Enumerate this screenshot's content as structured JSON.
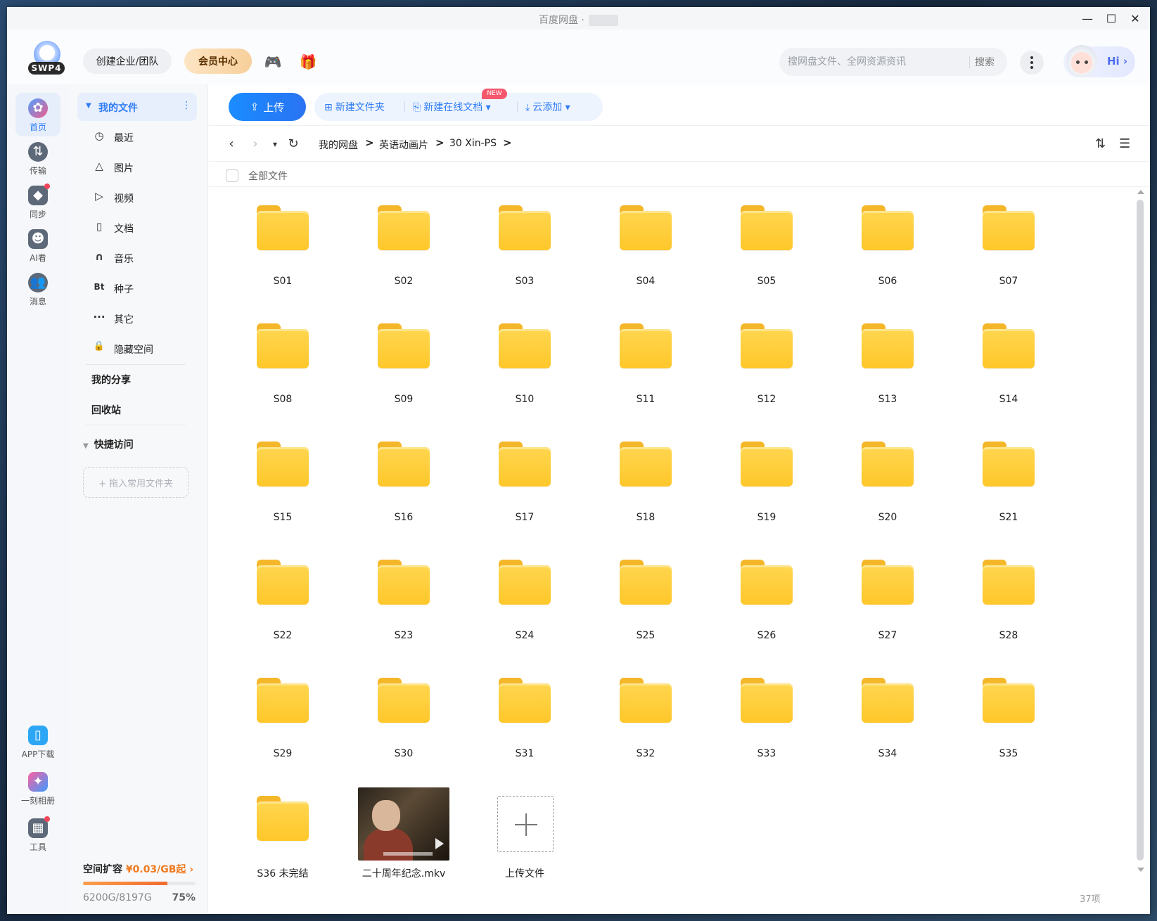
{
  "window": {
    "title": "百度网盘 ·",
    "controls": {
      "minimize": "—",
      "maximize": "☐",
      "close": "✕"
    }
  },
  "header": {
    "logo_badge": "SWP4",
    "team_button": "创建企业/团队",
    "vip_button": "会员中心",
    "game_icon": "🎮",
    "gift_icon": "🎁",
    "search": {
      "placeholder": "搜网盘文件、全网资源资讯",
      "button": "搜索"
    },
    "hi_label": "Hi ›"
  },
  "rail": {
    "items": [
      {
        "label": "首页",
        "icon": "home-icon",
        "active": true
      },
      {
        "label": "传输",
        "icon": "transfer-icon"
      },
      {
        "label": "同步",
        "icon": "sync-icon",
        "dot": true
      },
      {
        "label": "AI看",
        "icon": "ai-icon"
      },
      {
        "label": "消息",
        "icon": "message-icon"
      }
    ],
    "bottom": [
      {
        "label": "APP下载",
        "icon": "phone-icon"
      },
      {
        "label": "一刻相册",
        "icon": "album-icon"
      },
      {
        "label": "工具",
        "icon": "tools-icon",
        "dot": true
      }
    ]
  },
  "sidebar": {
    "my_files": "我的文件",
    "my_files_more": "⋮",
    "items": [
      {
        "icon": "◷",
        "label": "最近"
      },
      {
        "icon": "△",
        "label": "图片"
      },
      {
        "icon": "▷",
        "label": "视频"
      },
      {
        "icon": "▯",
        "label": "文档"
      },
      {
        "icon": "∩",
        "label": "音乐"
      },
      {
        "icon": "Bt",
        "label": "种子"
      },
      {
        "icon": "···",
        "label": "其它"
      },
      {
        "icon": "🔒",
        "label": "隐藏空间"
      }
    ],
    "my_share": "我的分享",
    "recycle": "回收站",
    "quick_access": "快捷访问",
    "dropzone": "+ 拖入常用文件夹",
    "quota": {
      "label": "空间扩容",
      "price": "¥0.03/GB起",
      "arrow": "›",
      "usage": "6200G/8197G",
      "percent": "75%",
      "fraction": 0.75
    }
  },
  "toolbar": {
    "upload": "上传",
    "new_folder": "新建文件夹",
    "new_doc": "新建在线文档",
    "new_tag": "NEW",
    "cloud_add": "云添加"
  },
  "breadcrumb": {
    "items": [
      "我的网盘",
      "英语动画片",
      "30 Xin-PS"
    ],
    "sep": ">"
  },
  "list": {
    "select_all_label": "全部文件",
    "folders": [
      "S01",
      "S02",
      "S03",
      "S04",
      "S05",
      "S06",
      "S07",
      "S08",
      "S09",
      "S10",
      "S11",
      "S12",
      "S13",
      "S14",
      "S15",
      "S16",
      "S17",
      "S18",
      "S19",
      "S20",
      "S21",
      "S22",
      "S23",
      "S24",
      "S25",
      "S26",
      "S27",
      "S28",
      "S29",
      "S30",
      "S31",
      "S32",
      "S33",
      "S34",
      "S35",
      "S36 未完结"
    ],
    "video": "二十周年纪念.mkv",
    "upload_tile": "上传文件",
    "count": "37项"
  },
  "colors": {
    "accent": "#2f7cf6",
    "folder": "#ffcb2f",
    "price": "#f07a1e"
  }
}
